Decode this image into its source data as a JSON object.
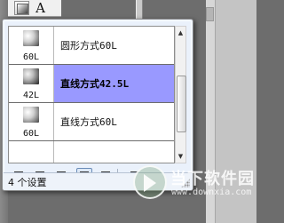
{
  "toolbar": {
    "text_tool_label": "A"
  },
  "brush_presets": {
    "items": [
      {
        "size": "60L",
        "name": "圆形方式60L",
        "selected": false,
        "thumb_style": "soft-square"
      },
      {
        "size": "42L",
        "name": "直线方式42.5L",
        "selected": true,
        "thumb_style": "soft-dark"
      },
      {
        "size": "60L",
        "name": "直线方式60L",
        "selected": false,
        "thumb_style": "soft-square"
      }
    ]
  },
  "view_buttons": [
    {
      "name": "small-thumbnail-view",
      "active": false
    },
    {
      "name": "large-thumbnail-view",
      "active": false
    },
    {
      "name": "wide-thumbnail-view",
      "active": false
    },
    {
      "name": "list-view",
      "active": true
    },
    {
      "name": "text-only-view",
      "active": false
    },
    {
      "name": "panel-menu",
      "active": false
    }
  ],
  "status": {
    "text": "4 个设置"
  },
  "watermark": {
    "title": "当下软件园",
    "url": "www.downxia.com"
  },
  "colors": {
    "selection": "#9999ff",
    "popup_bg": "#eaf1fb",
    "background": "#6d6d6d"
  }
}
